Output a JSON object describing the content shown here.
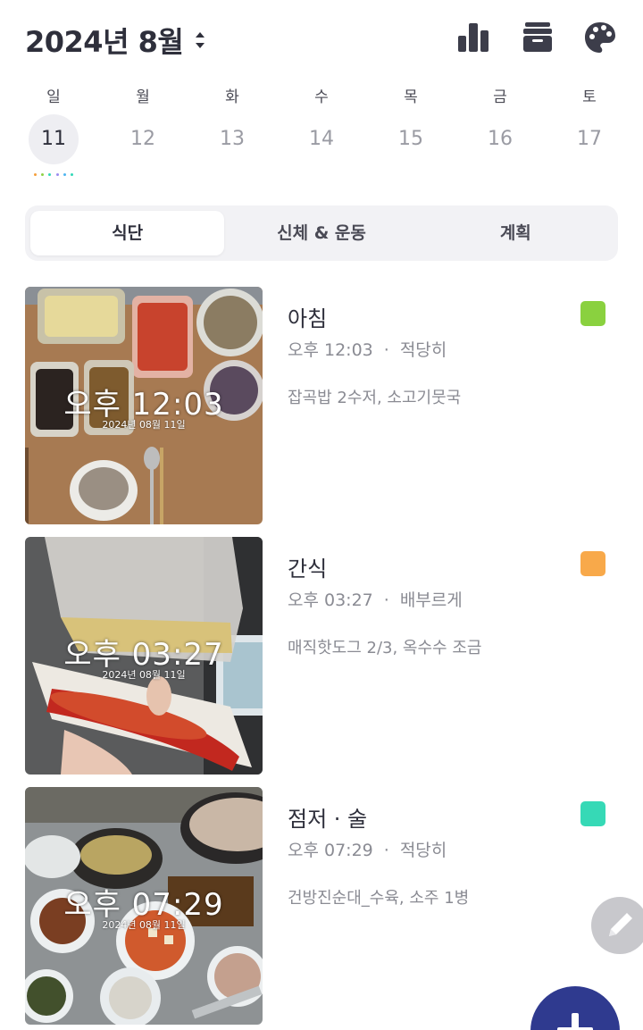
{
  "header": {
    "month_title": "2024년 8월",
    "icons": [
      "sort-updown-icon",
      "bar-chart-icon",
      "archive-box-icon",
      "palette-icon"
    ]
  },
  "week": {
    "days": [
      {
        "dow": "일",
        "date": "11",
        "selected": true
      },
      {
        "dow": "월",
        "date": "12",
        "selected": false
      },
      {
        "dow": "화",
        "date": "13",
        "selected": false
      },
      {
        "dow": "수",
        "date": "14",
        "selected": false
      },
      {
        "dow": "목",
        "date": "15",
        "selected": false
      },
      {
        "dow": "금",
        "date": "16",
        "selected": false
      },
      {
        "dow": "토",
        "date": "17",
        "selected": false
      }
    ],
    "indicator_dot_colors": [
      "#f5a03c",
      "#8fd146",
      "#32d9b8",
      "#9b8cf0",
      "#4fb5f0",
      "#32d9b8"
    ]
  },
  "tabs": [
    {
      "label": "식단",
      "active": true
    },
    {
      "label": "신체 & 운동",
      "active": false
    },
    {
      "label": "계획",
      "active": false
    }
  ],
  "entries": [
    {
      "meal": "아침",
      "time": "오후 12:03",
      "amount": "적당히",
      "description": "잡곡밥 2수저, 소고기뭇국",
      "color": "#8ad13f",
      "photo_stamp_time": "오후 12:03",
      "photo_stamp_date": "2024년 08월 11일"
    },
    {
      "meal": "간식",
      "time": "오후 03:27",
      "amount": "배부르게",
      "description": "매직핫도그 2/3, 옥수수 조금",
      "color": "#f8a94a",
      "photo_stamp_time": "오후 03:27",
      "photo_stamp_date": "2024년 08월 11일"
    },
    {
      "meal": "점저 · 술",
      "time": "오후 07:29",
      "amount": "적당히",
      "description": "건방진순대_수육, 소주 1병",
      "color": "#36d9b6",
      "photo_stamp_time": "오후 07:29",
      "photo_stamp_date": "2024년 08월 11일"
    }
  ],
  "fab": {
    "edit_icon": "pencil-icon",
    "add_icon": "plus-icon"
  },
  "colors": {
    "accent": "#2f3a8f",
    "selected_day_bg": "#eeeef2"
  }
}
